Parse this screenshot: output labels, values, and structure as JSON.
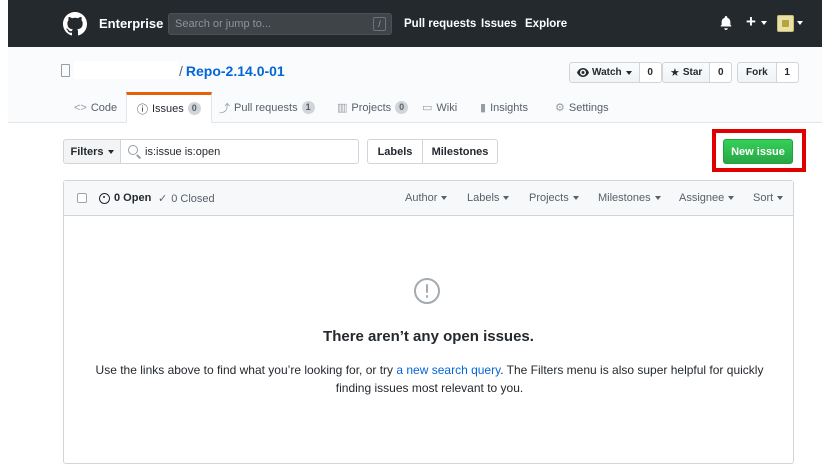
{
  "header": {
    "brand": "Enterprise",
    "search_placeholder": "Search or jump to...",
    "search_shortcut": "/",
    "nav": [
      "Pull requests",
      "Issues",
      "Explore"
    ],
    "plus": "+"
  },
  "repo": {
    "separator": "/",
    "name": "Repo-2.14.0-01",
    "watch": {
      "label": "Watch",
      "count": "0"
    },
    "star": {
      "label": "Star",
      "count": "0"
    },
    "fork": {
      "label": "Fork",
      "count": "1"
    }
  },
  "tabs": [
    {
      "label": "Code",
      "icon": "<>"
    },
    {
      "label": "Issues",
      "count": "0"
    },
    {
      "label": "Pull requests",
      "count": "1"
    },
    {
      "label": "Projects",
      "count": "0"
    },
    {
      "label": "Wiki"
    },
    {
      "label": "Insights"
    },
    {
      "label": "Settings"
    }
  ],
  "subnav": {
    "filters": "Filters",
    "query": "is:issue is:open",
    "labels": "Labels",
    "milestones": "Milestones",
    "new_issue": "New issue"
  },
  "issues": {
    "open": "0 Open",
    "closed": "0 Closed",
    "selects": [
      "Author",
      "Labels",
      "Projects",
      "Milestones",
      "Assignee",
      "Sort"
    ],
    "blank_title": "There aren’t any open issues.",
    "blank_desc_1": "Use the links above to find what you’re looking for, or try ",
    "blank_link": "a new search query",
    "blank_desc_2": ". The Filters menu is also super helpful for quickly finding issues most relevant to you."
  },
  "colors": {
    "accent": "#e36209",
    "primary": "#28a745",
    "highlight": "#e00000",
    "link": "#0366d6"
  }
}
